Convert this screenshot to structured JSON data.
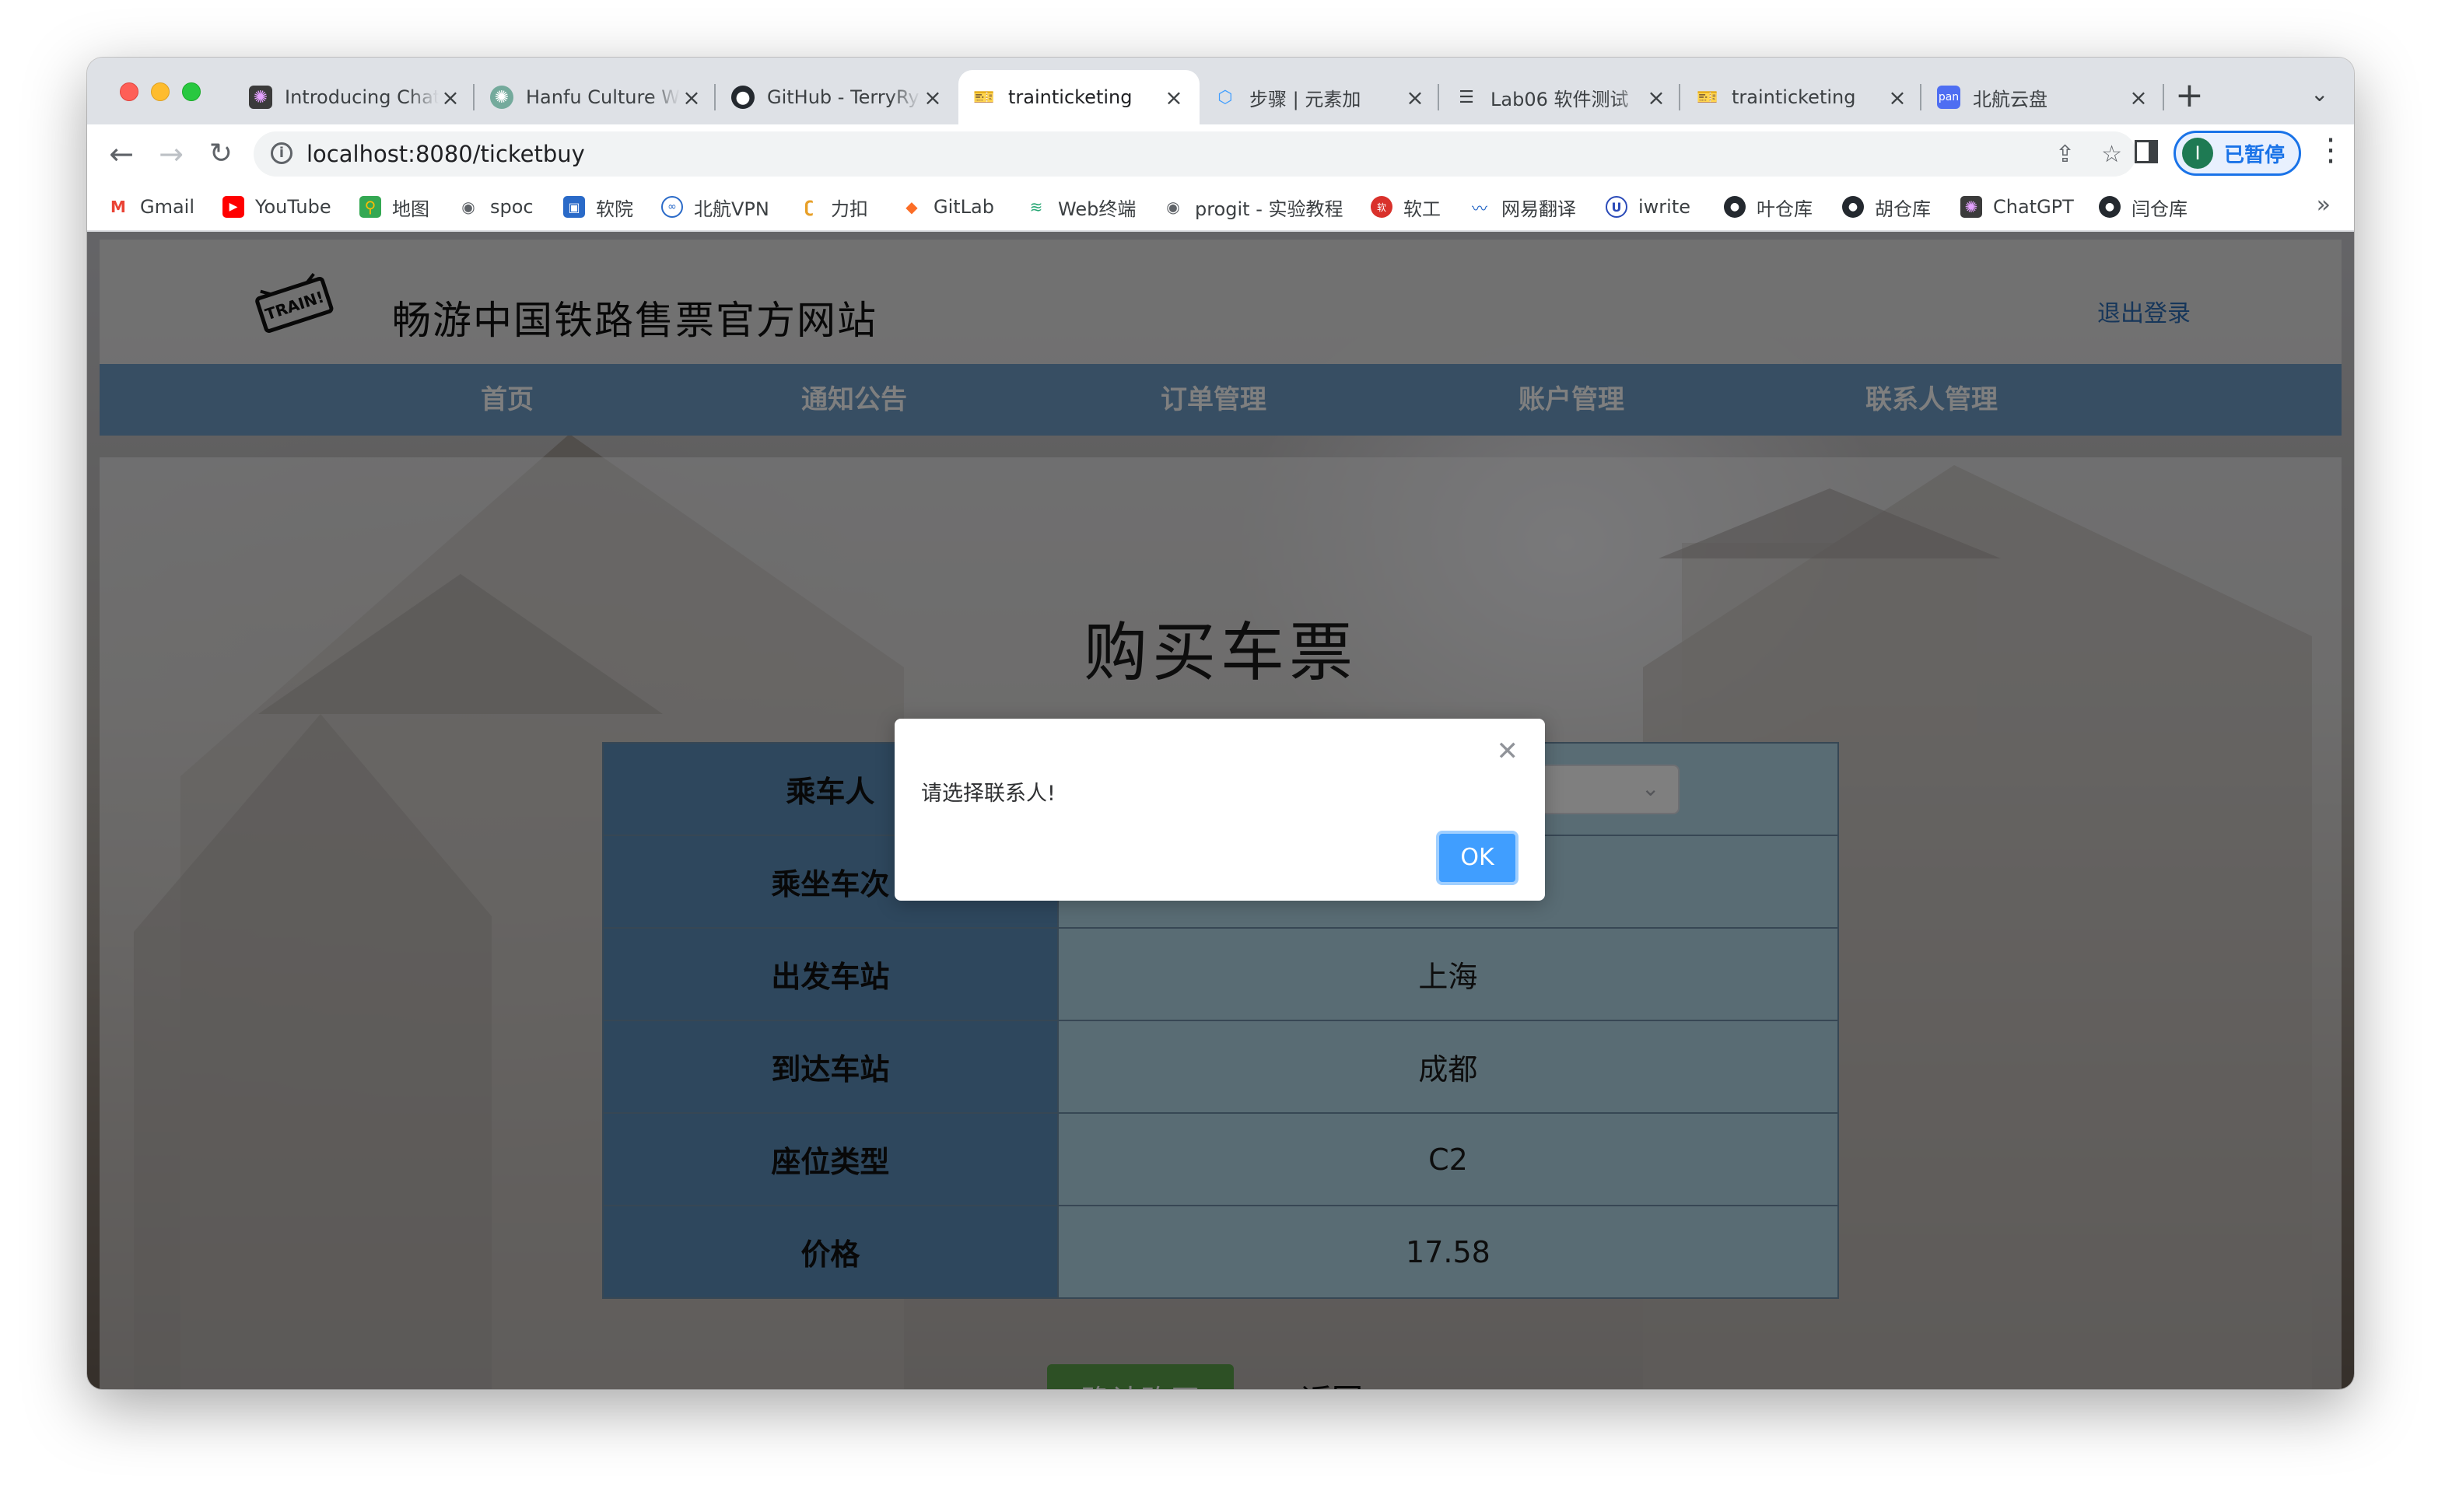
{
  "browser": {
    "tabs": [
      {
        "title": "Introducing ChatGPT",
        "icon": "openai-icon"
      },
      {
        "title": "Hanfu Culture Website",
        "icon": "chatgpt-icon"
      },
      {
        "title": "GitHub - TerryRyan",
        "icon": "github-icon"
      },
      {
        "title": "trainticketing",
        "icon": "ticket-icon"
      },
      {
        "title": "步骤 | 元素加",
        "icon": "element-plus-icon"
      },
      {
        "title": "Lab06 软件测试",
        "icon": "doc-icon"
      },
      {
        "title": "trainticketing",
        "icon": "ticket-icon"
      },
      {
        "title": "北航云盘",
        "icon": "pan-icon"
      }
    ],
    "close_glyph": "×",
    "new_tab_glyph": "+",
    "tab_menu_glyph": "⌄",
    "url": "localhost:8080/ticketbuy",
    "profile_initial": "I",
    "profile_label": "已暂停",
    "bookmarks": [
      {
        "label": "Gmail",
        "icon": "gmail-icon"
      },
      {
        "label": "YouTube",
        "icon": "youtube-icon"
      },
      {
        "label": "地图",
        "icon": "maps-icon"
      },
      {
        "label": "spoc",
        "icon": "globe-icon"
      },
      {
        "label": "软院",
        "icon": "school-icon"
      },
      {
        "label": "北航VPN",
        "icon": "vpn-icon"
      },
      {
        "label": "力扣",
        "icon": "leetcode-icon"
      },
      {
        "label": "GitLab",
        "icon": "gitlab-icon"
      },
      {
        "label": "Web终端",
        "icon": "terminal-icon"
      },
      {
        "label": "progit - 实验教程",
        "icon": "globe-icon"
      },
      {
        "label": "软工",
        "icon": "se-icon"
      },
      {
        "label": "网易翻译",
        "icon": "translate-icon"
      },
      {
        "label": "iwrite",
        "icon": "iwrite-icon"
      },
      {
        "label": "叶仓库",
        "icon": "github-icon"
      },
      {
        "label": "胡仓库",
        "icon": "github-icon"
      },
      {
        "label": "ChatGPT",
        "icon": "openai-icon"
      },
      {
        "label": "闫仓库",
        "icon": "github-icon"
      }
    ],
    "bookmarks_more": "»"
  },
  "site": {
    "title": "畅游中国铁路售票官方网站",
    "logout": "退出登录",
    "nav": [
      "首页",
      "通知公告",
      "订单管理",
      "账户管理",
      "联系人管理"
    ]
  },
  "form": {
    "heading": "购买车票",
    "rows": [
      {
        "label": "乘车人",
        "value": ""
      },
      {
        "label": "乘坐车次",
        "value": ""
      },
      {
        "label": "出发车站",
        "value": "上海"
      },
      {
        "label": "到达车站",
        "value": "成都"
      },
      {
        "label": "座位类型",
        "value": "C2"
      },
      {
        "label": "价格",
        "value": "17.58"
      }
    ],
    "confirm_label": "确认购买",
    "back_label": "返回"
  },
  "dialog": {
    "message": "请选择联系人!",
    "ok_label": "OK"
  },
  "colors": {
    "nav_bg": "#6e9dc6",
    "label_cell": "#5d8fbb",
    "value_cell": "#b3d9e8",
    "confirm_btn": "#5aa04a",
    "ok_btn": "#409eff",
    "profile_accent": "#1a73e8"
  }
}
